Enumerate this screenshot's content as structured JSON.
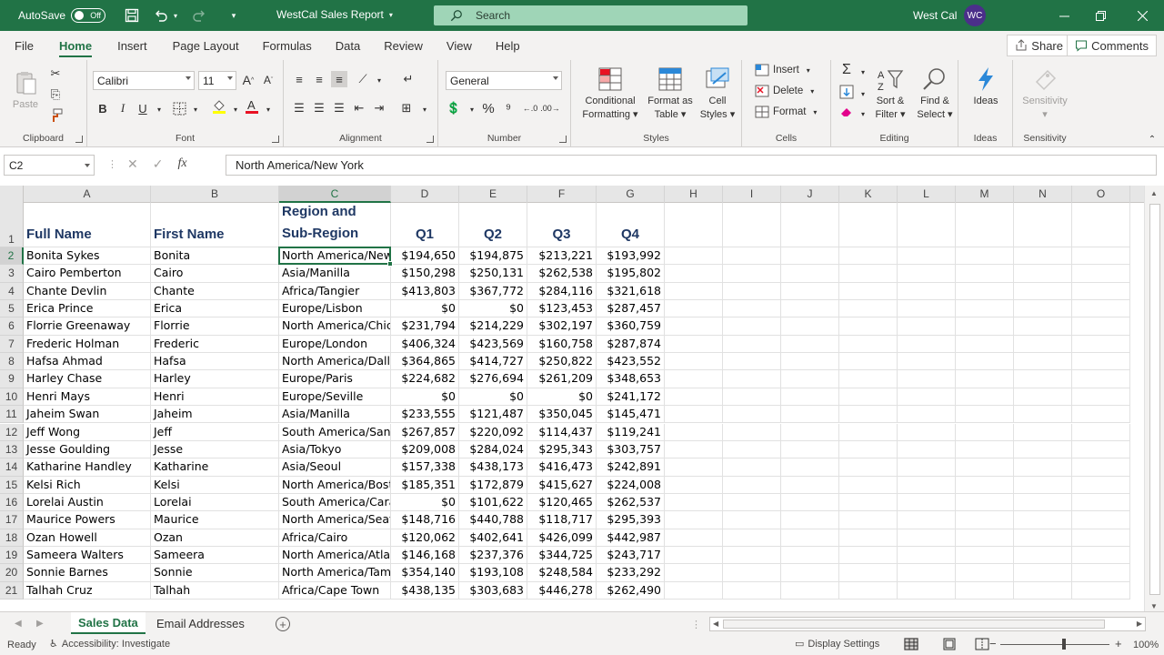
{
  "titlebar": {
    "autosave_label": "AutoSave",
    "autosave_state": "Off",
    "doc_title": "WestCal Sales Report",
    "search_placeholder": "Search",
    "user_name": "West Cal",
    "user_initials": "WC",
    "bg_color": "#217346"
  },
  "ribbon_tabs": [
    "File",
    "Home",
    "Insert",
    "Page Layout",
    "Formulas",
    "Data",
    "Review",
    "View",
    "Help"
  ],
  "active_tab": "Home",
  "share_label": "Share",
  "comments_label": "Comments",
  "ribbon": {
    "clipboard": {
      "label": "Clipboard",
      "paste": "Paste"
    },
    "font": {
      "label": "Font",
      "font_name": "Calibri",
      "font_size": "11",
      "bold": "B",
      "italic": "I",
      "underline": "U"
    },
    "alignment": {
      "label": "Alignment"
    },
    "number": {
      "label": "Number",
      "format": "General"
    },
    "styles": {
      "label": "Styles",
      "conditional": [
        "Conditional",
        "Formatting"
      ],
      "format_table": [
        "Format as",
        "Table"
      ],
      "cell_styles": [
        "Cell",
        "Styles"
      ]
    },
    "cells": {
      "label": "Cells",
      "insert": "Insert",
      "delete": "Delete",
      "format": "Format"
    },
    "editing": {
      "label": "Editing",
      "sort": [
        "Sort &",
        "Filter"
      ],
      "find": [
        "Find &",
        "Select"
      ]
    },
    "ideas": {
      "label": "Ideas",
      "button": "Ideas"
    },
    "sensitivity": {
      "label": "Sensitivity",
      "button": "Sensitivity"
    }
  },
  "formula_bar": {
    "name_box": "C2",
    "fx": "fx",
    "content": "North America/New York"
  },
  "grid": {
    "columns": [
      "A",
      "B",
      "C",
      "D",
      "E",
      "F",
      "G",
      "H",
      "I",
      "J",
      "K",
      "L",
      "M",
      "N",
      "O"
    ],
    "selected_column": "C",
    "selected_row": 2,
    "headers": [
      "Full Name",
      "First Name",
      "Region and\nSub-Region",
      "Q1",
      "Q2",
      "Q3",
      "Q4"
    ],
    "header_region_line1": "Region and",
    "header_region_line2": "Sub-Region",
    "rows": [
      [
        "Bonita Sykes",
        "Bonita",
        "North America/New",
        "$194,650",
        "$194,875",
        "$213,221",
        "$193,992"
      ],
      [
        "Cairo Pemberton",
        "Cairo",
        "Asia/Manilla",
        "$150,298",
        "$250,131",
        "$262,538",
        "$195,802"
      ],
      [
        "Chante Devlin",
        "Chante",
        "Africa/Tangier",
        "$413,803",
        "$367,772",
        "$284,116",
        "$321,618"
      ],
      [
        "Erica Prince",
        "Erica",
        "Europe/Lisbon",
        "$0",
        "$0",
        "$123,453",
        "$287,457"
      ],
      [
        "Florrie Greenaway",
        "Florrie",
        "North America/Chic",
        "$231,794",
        "$214,229",
        "$302,197",
        "$360,759"
      ],
      [
        "Frederic Holman",
        "Frederic",
        "Europe/London",
        "$406,324",
        "$423,569",
        "$160,758",
        "$287,874"
      ],
      [
        "Hafsa Ahmad",
        "Hafsa",
        "North America/Dall",
        "$364,865",
        "$414,727",
        "$250,822",
        "$423,552"
      ],
      [
        "Harley Chase",
        "Harley",
        "Europe/Paris",
        "$224,682",
        "$276,694",
        "$261,209",
        "$348,653"
      ],
      [
        "Henri Mays",
        "Henri",
        "Europe/Seville",
        "$0",
        "$0",
        "$0",
        "$241,172"
      ],
      [
        "Jaheim Swan",
        "Jaheim",
        "Asia/Manilla",
        "$233,555",
        "$121,487",
        "$350,045",
        "$145,471"
      ],
      [
        "Jeff Wong",
        "Jeff",
        "South America/Sant",
        "$267,857",
        "$220,092",
        "$114,437",
        "$119,241"
      ],
      [
        "Jesse Goulding",
        "Jesse",
        "Asia/Tokyo",
        "$209,008",
        "$284,024",
        "$295,343",
        "$303,757"
      ],
      [
        "Katharine Handley",
        "Katharine",
        "Asia/Seoul",
        "$157,338",
        "$438,173",
        "$416,473",
        "$242,891"
      ],
      [
        "Kelsi Rich",
        "Kelsi",
        "North America/Bost",
        "$185,351",
        "$172,879",
        "$415,627",
        "$224,008"
      ],
      [
        "Lorelai Austin",
        "Lorelai",
        "South America/Cara",
        "$0",
        "$101,622",
        "$120,465",
        "$262,537"
      ],
      [
        "Maurice Powers",
        "Maurice",
        "North America/Seat",
        "$148,716",
        "$440,788",
        "$118,717",
        "$295,393"
      ],
      [
        "Ozan Howell",
        "Ozan",
        "Africa/Cairo",
        "$120,062",
        "$402,641",
        "$426,099",
        "$442,987"
      ],
      [
        "Sameera Walters",
        "Sameera",
        "North America/Atla",
        "$146,168",
        "$237,376",
        "$344,725",
        "$243,717"
      ],
      [
        "Sonnie Barnes",
        "Sonnie",
        "North America/Tam",
        "$354,140",
        "$193,108",
        "$248,584",
        "$233,292"
      ],
      [
        "Talhah Cruz",
        "Talhah",
        "Africa/Cape Town",
        "$438,135",
        "$303,683",
        "$446,278",
        "$262,490"
      ]
    ]
  },
  "sheets": [
    "Sales Data",
    "Email Addresses"
  ],
  "active_sheet": "Sales Data",
  "status": {
    "ready": "Ready",
    "accessibility": "Accessibility: Investigate",
    "display_settings": "Display Settings",
    "zoom": "100%"
  }
}
